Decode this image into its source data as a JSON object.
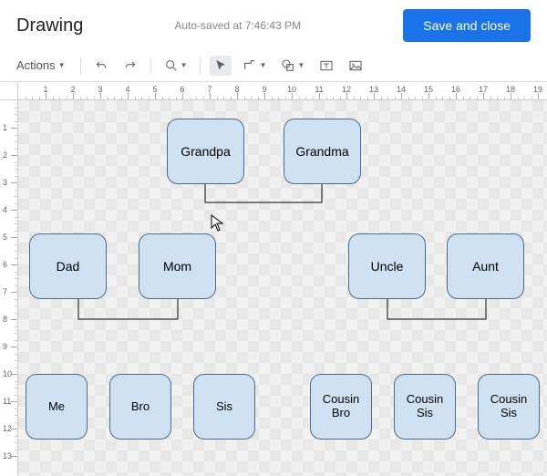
{
  "header": {
    "title": "Drawing",
    "autosave_label": "Auto-saved at 7:46:43 PM",
    "save_and_close_label": "Save and close"
  },
  "toolbar": {
    "actions_label": "Actions",
    "undo_tooltip": "Undo",
    "redo_tooltip": "Redo",
    "zoom_tooltip": "Zoom",
    "select_tooltip": "Select",
    "line_tooltip": "Line",
    "shape_tooltip": "Shape",
    "textbox_tooltip": "Text box",
    "image_tooltip": "Image"
  },
  "ruler": {
    "h_labels": [
      "1",
      "2",
      "3",
      "4",
      "5",
      "6",
      "7",
      "8",
      "9",
      "10",
      "11",
      "12",
      "13",
      "14",
      "15",
      "16",
      "17",
      "18",
      "19"
    ],
    "v_labels": [
      "1",
      "2",
      "3",
      "4",
      "5",
      "6",
      "7",
      "8",
      "9",
      "10",
      "11",
      "12",
      "13"
    ]
  },
  "nodes": {
    "grandpa": "Grandpa",
    "grandma": "Grandma",
    "dad": "Dad",
    "mom": "Mom",
    "uncle": "Uncle",
    "aunt": "Aunt",
    "me": "Me",
    "bro": "Bro",
    "sis": "Sis",
    "cousin_bro": "Cousin Bro",
    "cousin_sis1": "Cousin Sis",
    "cousin_sis2": "Cousin Sis"
  },
  "colors": {
    "node_fill": "#cfe2f3",
    "node_stroke": "#4a6d8c",
    "primary_button": "#1a73e8"
  }
}
